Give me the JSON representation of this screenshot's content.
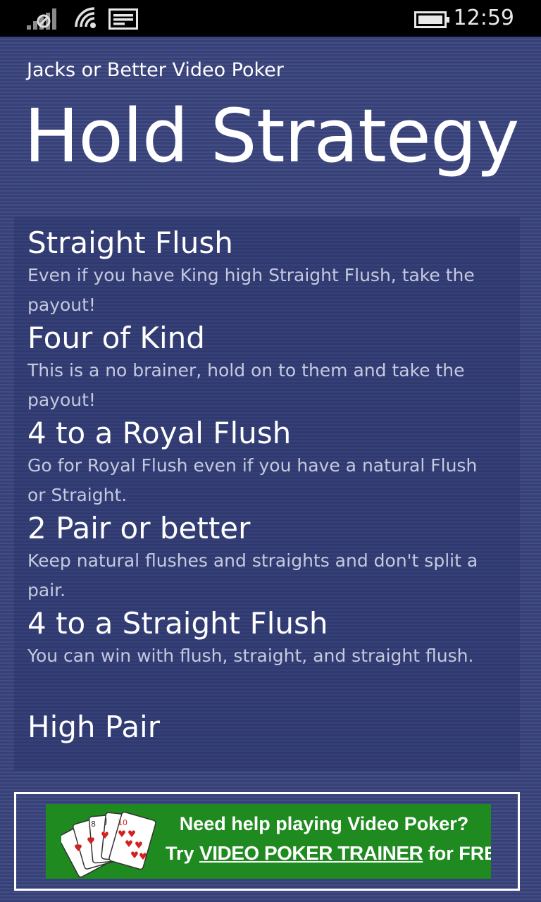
{
  "status_bar": {
    "time": "12:59",
    "icons": [
      "signal-no-sim-icon",
      "wifi-icon",
      "message-icon",
      "battery-icon"
    ]
  },
  "header": {
    "app_title": "Jacks or Better Video Poker",
    "page_title": "Hold Strategy"
  },
  "strategy": [
    {
      "title": "Straight Flush",
      "desc": "Even if you have King high Straight Flush, take the payout!"
    },
    {
      "title": "Four of Kind",
      "desc": "This is a no brainer, hold on to them and take the payout!"
    },
    {
      "title": "4 to a Royal Flush",
      "desc": "Go for Royal Flush even if you have a natural Flush or Straight."
    },
    {
      "title": "2 Pair or better",
      "desc": "Keep natural flushes and straights and don't split a pair."
    },
    {
      "title": "4 to a Straight Flush",
      "desc": "You can win with flush, straight, and straight flush."
    },
    {
      "title": "High Pair",
      "desc": ""
    }
  ],
  "ad": {
    "line1": "Need help playing Video Poker?",
    "line2_prefix": "Try ",
    "line2_link": "VIDEO POKER TRAINER",
    "line2_suffix": " for FREE!",
    "background_color": "#1f8a1f",
    "icon": "playing-cards-icon"
  },
  "colors": {
    "background": "#3a457f",
    "status_bar": "#000000",
    "description_text": "#c5c9de"
  }
}
